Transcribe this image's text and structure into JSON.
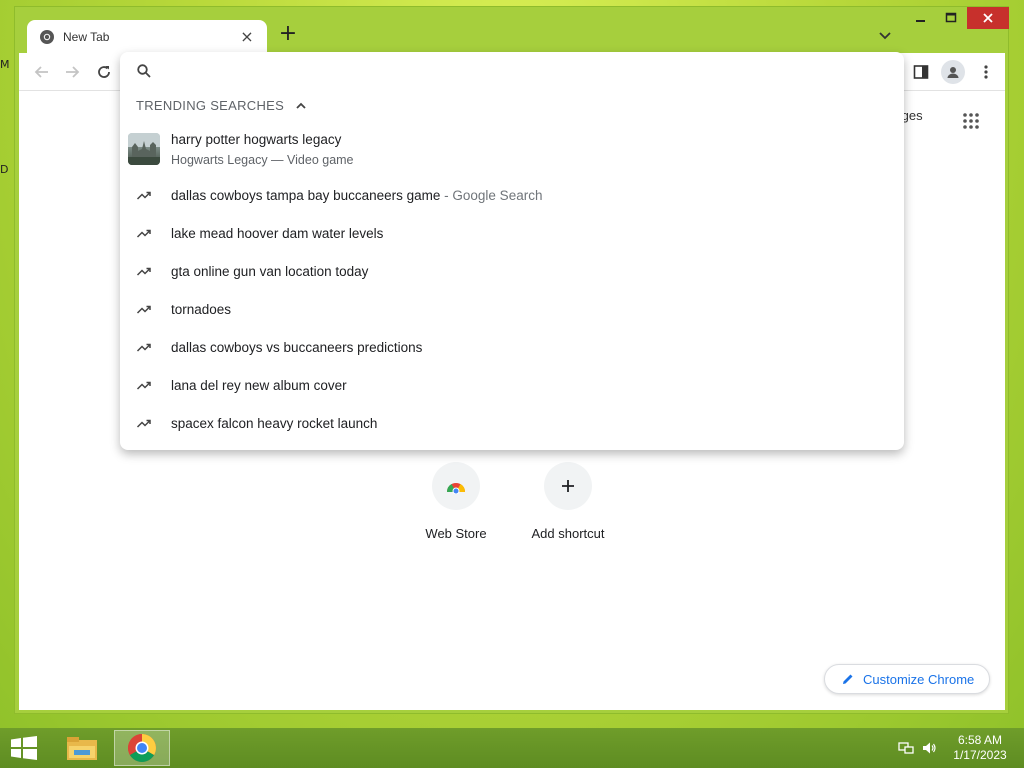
{
  "desktop": {
    "edge_letters": [
      "M",
      "D"
    ]
  },
  "browser": {
    "tab": {
      "title": "New Tab"
    },
    "omnibox": {
      "placeholder": "",
      "trending_header": "TRENDING SEARCHES",
      "rich_suggestion": {
        "title": "harry potter hogwarts legacy",
        "subtitle": "Hogwarts Legacy — Video game"
      },
      "suggestions": [
        {
          "text": "dallas cowboys tampa bay buccaneers game",
          "sub": " - Google Search"
        },
        {
          "text": "lake mead hoover dam water levels",
          "sub": ""
        },
        {
          "text": "gta online gun van location today",
          "sub": ""
        },
        {
          "text": "tornadoes",
          "sub": ""
        },
        {
          "text": "dallas cowboys vs buccaneers predictions",
          "sub": ""
        },
        {
          "text": "lana del rey new album cover",
          "sub": ""
        },
        {
          "text": "spacex falcon heavy rocket launch",
          "sub": ""
        }
      ]
    },
    "ntp": {
      "images_link": "Images",
      "shortcuts": [
        {
          "label": "Web Store",
          "icon": "chrome-webstore-icon"
        },
        {
          "label": "Add shortcut",
          "icon": "plus-icon"
        }
      ],
      "customize_label": "Customize Chrome"
    }
  },
  "taskbar": {
    "time": "6:58 AM",
    "date": "1/17/2023",
    "apps": [
      "file-explorer-icon",
      "chrome-icon"
    ]
  },
  "colors": {
    "desktop": "#b8d83a",
    "frame": "#a6cf3d",
    "close": "#c7302c",
    "accent": "#1a73e8",
    "taskbar": "#5e8c22"
  }
}
